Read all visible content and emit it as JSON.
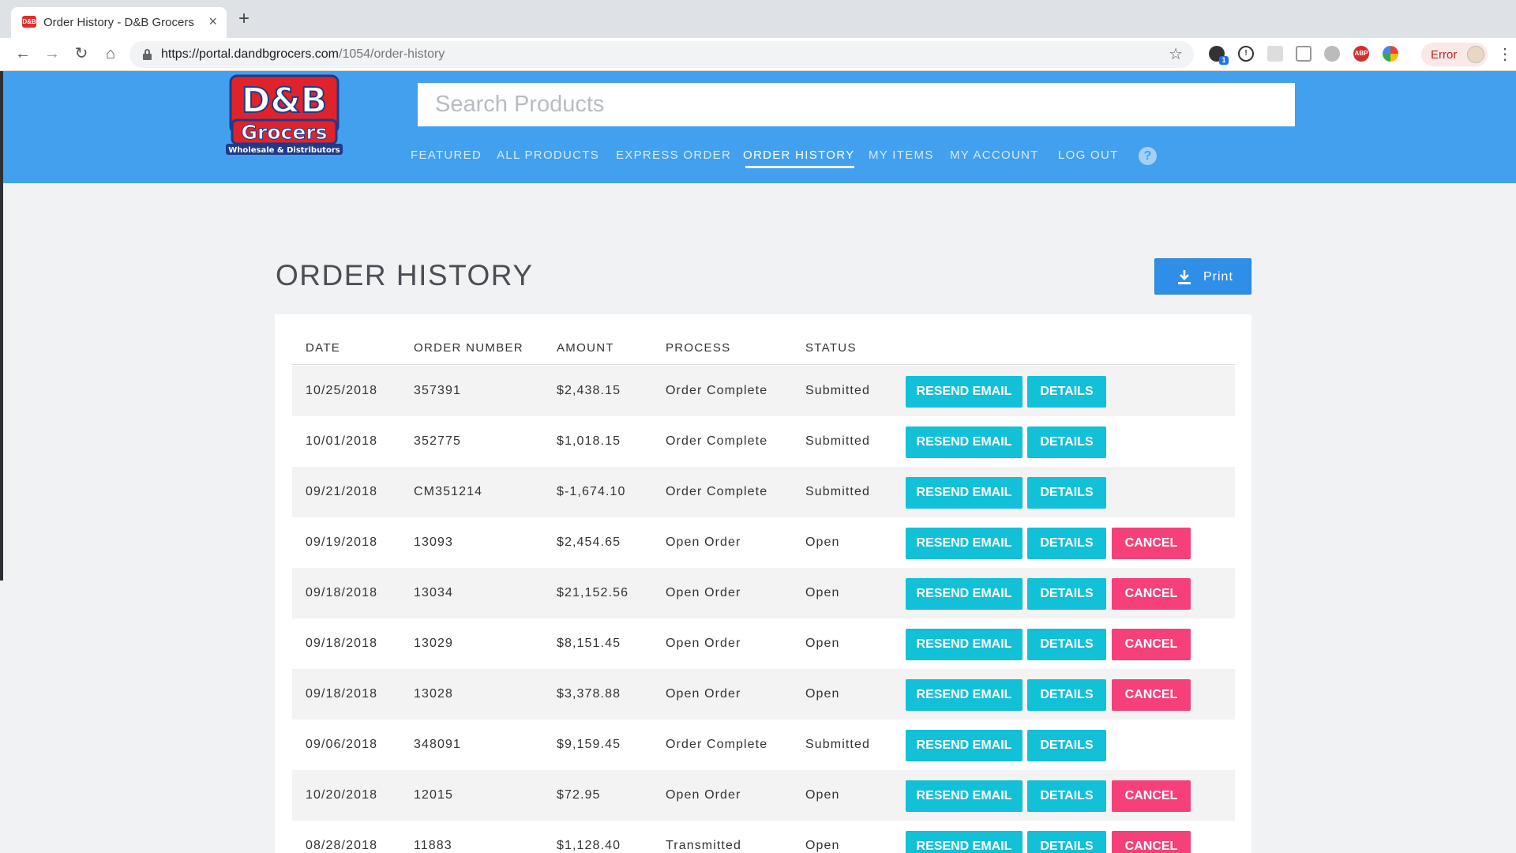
{
  "browser": {
    "tab_title": "Order History - D&B Grocers",
    "favicon_text": "D&B",
    "url_host": "https://portal.dandbgrocers.com",
    "url_path": "/1054/order-history",
    "profile_status": "Error",
    "extension_badge": "1"
  },
  "header": {
    "logo_line1": "D&B",
    "logo_line2": "Grocers",
    "logo_tagline": "Wholesale & Distributors",
    "search_placeholder": "Search Products",
    "nav": [
      "FEATURED",
      "ALL PRODUCTS",
      "EXPRESS ORDER",
      "ORDER HISTORY",
      "MY ITEMS",
      "MY ACCOUNT",
      "LOG OUT"
    ],
    "active_nav": "ORDER HISTORY",
    "help": "?"
  },
  "page": {
    "title": "ORDER HISTORY",
    "print_label": "Print"
  },
  "table": {
    "columns": [
      "DATE",
      "ORDER NUMBER",
      "AMOUNT",
      "PROCESS",
      "STATUS"
    ],
    "buttons": {
      "resend": "RESEND EMAIL",
      "details": "DETAILS",
      "cancel": "CANCEL"
    },
    "rows": [
      {
        "date": "10/25/2018",
        "order": "357391",
        "amount": "$2,438.15",
        "process": "Order Complete",
        "status": "Submitted",
        "cancel": false
      },
      {
        "date": "10/01/2018",
        "order": "352775",
        "amount": "$1,018.15",
        "process": "Order Complete",
        "status": "Submitted",
        "cancel": false
      },
      {
        "date": "09/21/2018",
        "order": "CM351214",
        "amount": "$-1,674.10",
        "process": "Order Complete",
        "status": "Submitted",
        "cancel": false
      },
      {
        "date": "09/19/2018",
        "order": "13093",
        "amount": "$2,454.65",
        "process": "Open Order",
        "status": "Open",
        "cancel": true
      },
      {
        "date": "09/18/2018",
        "order": "13034",
        "amount": "$21,152.56",
        "process": "Open Order",
        "status": "Open",
        "cancel": true
      },
      {
        "date": "09/18/2018",
        "order": "13029",
        "amount": "$8,151.45",
        "process": "Open Order",
        "status": "Open",
        "cancel": true
      },
      {
        "date": "09/18/2018",
        "order": "13028",
        "amount": "$3,378.88",
        "process": "Open Order",
        "status": "Open",
        "cancel": true
      },
      {
        "date": "09/06/2018",
        "order": "348091",
        "amount": "$9,159.45",
        "process": "Order Complete",
        "status": "Submitted",
        "cancel": false
      },
      {
        "date": "10/20/2018",
        "order": "12015",
        "amount": "$72.95",
        "process": "Open Order",
        "status": "Open",
        "cancel": true
      },
      {
        "date": "08/28/2018",
        "order": "11883",
        "amount": "$1,128.40",
        "process": "Transmitted",
        "status": "Open",
        "cancel": true
      }
    ]
  },
  "colors": {
    "header_blue": "#42a0ef",
    "action_cyan": "#12c0d8",
    "cancel_pink": "#f5407a",
    "print_blue": "#2f8fe8"
  }
}
